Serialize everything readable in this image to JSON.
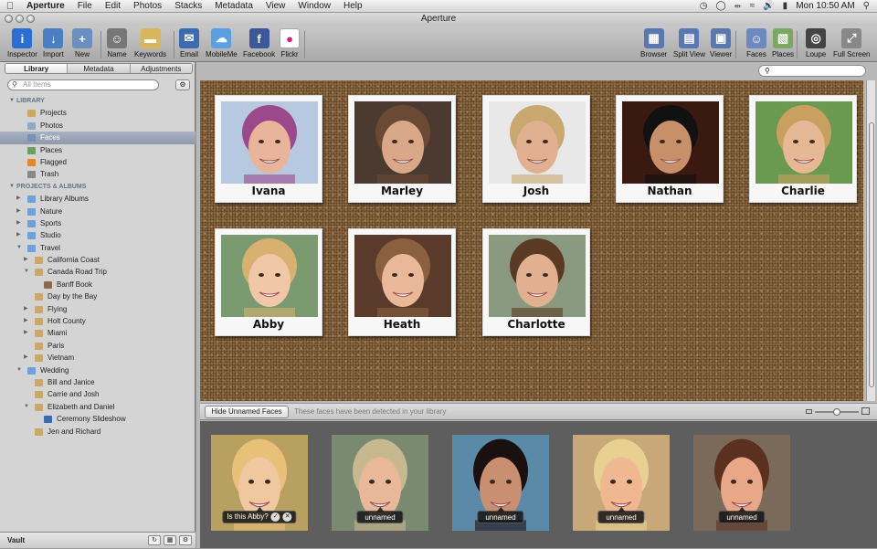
{
  "menubar": {
    "app_name": "Aperture",
    "items": [
      "File",
      "Edit",
      "Photos",
      "Stacks",
      "Metadata",
      "View",
      "Window",
      "Help"
    ],
    "clock": "Mon 10:50 AM"
  },
  "window": {
    "title": "Aperture"
  },
  "toolbar": {
    "left": [
      {
        "label": "Inspector",
        "icon": "info-icon",
        "color": "#2a6fd6"
      },
      {
        "label": "Import",
        "icon": "import-arrow-icon",
        "color": "#4a7fc4"
      },
      {
        "label": "New",
        "icon": "new-album-icon",
        "color": "#6b8fbf"
      },
      {
        "label": "Name",
        "icon": "person-icon",
        "color": "#777"
      },
      {
        "label": "Keywords",
        "icon": "tag-icon",
        "color": "#d9b65a"
      },
      {
        "label": "Email",
        "icon": "email-icon",
        "color": "#3b6bb0"
      },
      {
        "label": "MobileMe",
        "icon": "cloud-icon",
        "color": "#5aa0e0"
      },
      {
        "label": "Facebook",
        "icon": "facebook-icon",
        "color": "#3b5998"
      },
      {
        "label": "Flickr",
        "icon": "flickr-icon",
        "color": "#ffffff"
      }
    ],
    "right": [
      {
        "label": "Browser",
        "icon": "grid-icon",
        "color": "#5a78b0"
      },
      {
        "label": "Split View",
        "icon": "split-view-icon",
        "color": "#5a78b0"
      },
      {
        "label": "Viewer",
        "icon": "viewer-icon",
        "color": "#5a78b0"
      },
      {
        "label": "Faces",
        "icon": "faces-icon",
        "color": "#6a8ac0"
      },
      {
        "label": "Places",
        "icon": "map-icon",
        "color": "#7aa860"
      },
      {
        "label": "Loupe",
        "icon": "loupe-icon",
        "color": "#444"
      },
      {
        "label": "Full Screen",
        "icon": "fullscreen-icon",
        "color": "#888"
      }
    ]
  },
  "sidebar": {
    "tabs": [
      "Library",
      "Metadata",
      "Adjustments"
    ],
    "active_tab": "Library",
    "search_placeholder": "All Items",
    "tree": [
      {
        "label": "LIBRARY",
        "level": 0,
        "type": "header",
        "expanded": true
      },
      {
        "label": "Projects",
        "level": 1,
        "icon": "projects-icon",
        "color": "#c9a86a"
      },
      {
        "label": "Photos",
        "level": 1,
        "icon": "photos-icon",
        "color": "#8fa9c9"
      },
      {
        "label": "Faces",
        "level": 1,
        "icon": "faces-icon",
        "color": "#7a8fb4",
        "selected": true
      },
      {
        "label": "Places",
        "level": 1,
        "icon": "places-icon",
        "color": "#6aa060"
      },
      {
        "label": "Flagged",
        "level": 1,
        "icon": "flag-icon",
        "color": "#e08a2a"
      },
      {
        "label": "Trash",
        "level": 1,
        "icon": "trash-icon",
        "color": "#888"
      },
      {
        "label": "PROJECTS & ALBUMS",
        "level": 0,
        "type": "header",
        "expanded": true
      },
      {
        "label": "Library Albums",
        "level": 1,
        "icon": "folder-icon",
        "color": "#6fa0d8",
        "collapsed": true
      },
      {
        "label": "Nature",
        "level": 1,
        "icon": "folder-icon",
        "color": "#6fa0d8",
        "collapsed": true
      },
      {
        "label": "Sports",
        "level": 1,
        "icon": "folder-icon",
        "color": "#6fa0d8",
        "collapsed": true
      },
      {
        "label": "Studio",
        "level": 1,
        "icon": "folder-icon",
        "color": "#6fa0d8",
        "collapsed": true
      },
      {
        "label": "Travel",
        "level": 1,
        "icon": "folder-icon",
        "color": "#6fa0d8",
        "expanded": true
      },
      {
        "label": "California Coast",
        "level": 2,
        "icon": "project-icon",
        "color": "#c9a86a",
        "collapsed": true
      },
      {
        "label": "Canada Road Trip",
        "level": 2,
        "icon": "project-icon",
        "color": "#c9a86a",
        "expanded": true
      },
      {
        "label": "Banff Book",
        "level": 3,
        "icon": "book-icon",
        "color": "#8a6a4a"
      },
      {
        "label": "Day by the Bay",
        "level": 2,
        "icon": "project-icon",
        "color": "#c9a86a"
      },
      {
        "label": "Flying",
        "level": 2,
        "icon": "project-icon",
        "color": "#c9a86a",
        "collapsed": true
      },
      {
        "label": "Holt County",
        "level": 2,
        "icon": "project-icon",
        "color": "#c9a86a",
        "collapsed": true
      },
      {
        "label": "Miami",
        "level": 2,
        "icon": "project-icon",
        "color": "#c9a86a",
        "collapsed": true
      },
      {
        "label": "Paris",
        "level": 2,
        "icon": "project-icon",
        "color": "#c9a86a"
      },
      {
        "label": "Vietnam",
        "level": 2,
        "icon": "project-icon",
        "color": "#c9a86a",
        "collapsed": true
      },
      {
        "label": "Wedding",
        "level": 1,
        "icon": "folder-icon",
        "color": "#6fa0d8",
        "expanded": true
      },
      {
        "label": "Bill and Janice",
        "level": 2,
        "icon": "project-icon",
        "color": "#c9a86a"
      },
      {
        "label": "Carrie and Josh",
        "level": 2,
        "icon": "project-icon",
        "color": "#c9a86a"
      },
      {
        "label": "Elizabeth and Daniel",
        "level": 2,
        "icon": "project-icon",
        "color": "#c9a86a",
        "expanded": true
      },
      {
        "label": "Ceremony Slideshow",
        "level": 3,
        "icon": "slideshow-icon",
        "color": "#3a6ab0"
      },
      {
        "label": "Jen and Richard",
        "level": 2,
        "icon": "project-icon",
        "color": "#c9a86a"
      }
    ],
    "vault_label": "Vault"
  },
  "faces": [
    {
      "name": "Ivana",
      "colors": [
        "#b7c9e0",
        "#e8b49a",
        "#9a4a8a"
      ]
    },
    {
      "name": "Marley",
      "colors": [
        "#4a3a30",
        "#d9a888",
        "#6a4a35"
      ]
    },
    {
      "name": "Josh",
      "colors": [
        "#e8e8e8",
        "#e0b090",
        "#c9a870"
      ]
    },
    {
      "name": "Nathan",
      "colors": [
        "#3a1a10",
        "#c89068",
        "#111"
      ]
    },
    {
      "name": "Charlie",
      "colors": [
        "#6a9a50",
        "#e6b896",
        "#c9a060"
      ]
    },
    {
      "name": "Abby",
      "colors": [
        "#7a9a70",
        "#f0c8a8",
        "#d8b070"
      ]
    },
    {
      "name": "Heath",
      "colors": [
        "#5a3a2a",
        "#e8b898",
        "#8a6040"
      ]
    },
    {
      "name": "Charlotte",
      "colors": [
        "#8a9a80",
        "#e0b090",
        "#5a3a25"
      ]
    }
  ],
  "facebar": {
    "hide_button": "Hide Unnamed Faces",
    "message": "These faces have been detected in your library"
  },
  "unnamed_faces": [
    {
      "label": "Is this Abby?",
      "suggest": true,
      "colors": [
        "#b8a060",
        "#f0c8a0",
        "#e8c078"
      ]
    },
    {
      "label": "unnamed",
      "colors": [
        "#7a8a70",
        "#e8b898",
        "#c8b890"
      ]
    },
    {
      "label": "unnamed",
      "colors": [
        "#5a8aa8",
        "#c89070",
        "#1a1010"
      ]
    },
    {
      "label": "unnamed",
      "colors": [
        "#c8a878",
        "#f0b890",
        "#e8d090"
      ]
    },
    {
      "label": "unnamed",
      "colors": [
        "#7a6a5a",
        "#e8a888",
        "#5a3020"
      ]
    }
  ]
}
